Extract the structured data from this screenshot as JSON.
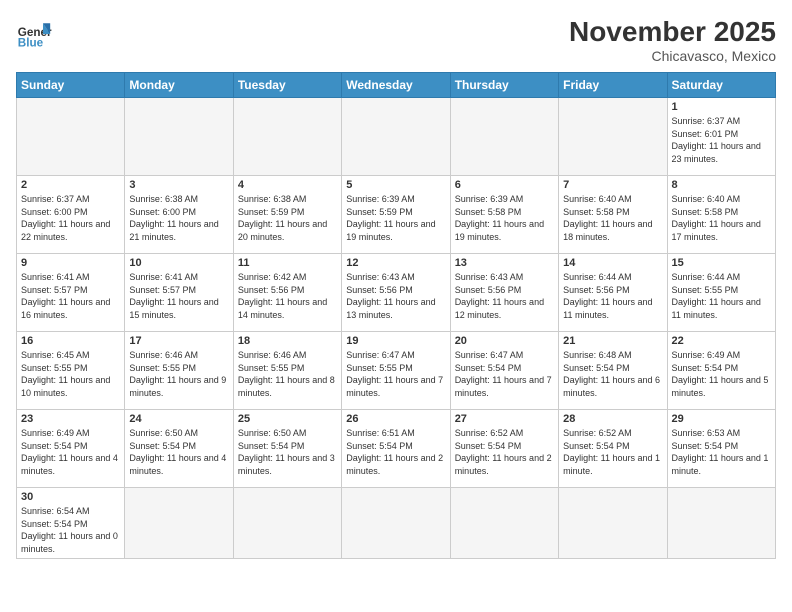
{
  "header": {
    "logo_general": "General",
    "logo_blue": "Blue",
    "month_title": "November 2025",
    "location": "Chicavasco, Mexico"
  },
  "weekdays": [
    "Sunday",
    "Monday",
    "Tuesday",
    "Wednesday",
    "Thursday",
    "Friday",
    "Saturday"
  ],
  "weeks": [
    [
      {
        "day": "",
        "empty": true
      },
      {
        "day": "",
        "empty": true
      },
      {
        "day": "",
        "empty": true
      },
      {
        "day": "",
        "empty": true
      },
      {
        "day": "",
        "empty": true
      },
      {
        "day": "",
        "empty": true
      },
      {
        "day": "1",
        "sunrise": "6:37 AM",
        "sunset": "6:01 PM",
        "daylight": "11 hours and 23 minutes."
      }
    ],
    [
      {
        "day": "2",
        "sunrise": "6:37 AM",
        "sunset": "6:00 PM",
        "daylight": "11 hours and 22 minutes."
      },
      {
        "day": "3",
        "sunrise": "6:38 AM",
        "sunset": "6:00 PM",
        "daylight": "11 hours and 21 minutes."
      },
      {
        "day": "4",
        "sunrise": "6:38 AM",
        "sunset": "5:59 PM",
        "daylight": "11 hours and 20 minutes."
      },
      {
        "day": "5",
        "sunrise": "6:39 AM",
        "sunset": "5:59 PM",
        "daylight": "11 hours and 19 minutes."
      },
      {
        "day": "6",
        "sunrise": "6:39 AM",
        "sunset": "5:58 PM",
        "daylight": "11 hours and 19 minutes."
      },
      {
        "day": "7",
        "sunrise": "6:40 AM",
        "sunset": "5:58 PM",
        "daylight": "11 hours and 18 minutes."
      },
      {
        "day": "8",
        "sunrise": "6:40 AM",
        "sunset": "5:58 PM",
        "daylight": "11 hours and 17 minutes."
      }
    ],
    [
      {
        "day": "9",
        "sunrise": "6:41 AM",
        "sunset": "5:57 PM",
        "daylight": "11 hours and 16 minutes."
      },
      {
        "day": "10",
        "sunrise": "6:41 AM",
        "sunset": "5:57 PM",
        "daylight": "11 hours and 15 minutes."
      },
      {
        "day": "11",
        "sunrise": "6:42 AM",
        "sunset": "5:56 PM",
        "daylight": "11 hours and 14 minutes."
      },
      {
        "day": "12",
        "sunrise": "6:43 AM",
        "sunset": "5:56 PM",
        "daylight": "11 hours and 13 minutes."
      },
      {
        "day": "13",
        "sunrise": "6:43 AM",
        "sunset": "5:56 PM",
        "daylight": "11 hours and 12 minutes."
      },
      {
        "day": "14",
        "sunrise": "6:44 AM",
        "sunset": "5:56 PM",
        "daylight": "11 hours and 11 minutes."
      },
      {
        "day": "15",
        "sunrise": "6:44 AM",
        "sunset": "5:55 PM",
        "daylight": "11 hours and 11 minutes."
      }
    ],
    [
      {
        "day": "16",
        "sunrise": "6:45 AM",
        "sunset": "5:55 PM",
        "daylight": "11 hours and 10 minutes."
      },
      {
        "day": "17",
        "sunrise": "6:46 AM",
        "sunset": "5:55 PM",
        "daylight": "11 hours and 9 minutes."
      },
      {
        "day": "18",
        "sunrise": "6:46 AM",
        "sunset": "5:55 PM",
        "daylight": "11 hours and 8 minutes."
      },
      {
        "day": "19",
        "sunrise": "6:47 AM",
        "sunset": "5:55 PM",
        "daylight": "11 hours and 7 minutes."
      },
      {
        "day": "20",
        "sunrise": "6:47 AM",
        "sunset": "5:54 PM",
        "daylight": "11 hours and 7 minutes."
      },
      {
        "day": "21",
        "sunrise": "6:48 AM",
        "sunset": "5:54 PM",
        "daylight": "11 hours and 6 minutes."
      },
      {
        "day": "22",
        "sunrise": "6:49 AM",
        "sunset": "5:54 PM",
        "daylight": "11 hours and 5 minutes."
      }
    ],
    [
      {
        "day": "23",
        "sunrise": "6:49 AM",
        "sunset": "5:54 PM",
        "daylight": "11 hours and 4 minutes."
      },
      {
        "day": "24",
        "sunrise": "6:50 AM",
        "sunset": "5:54 PM",
        "daylight": "11 hours and 4 minutes."
      },
      {
        "day": "25",
        "sunrise": "6:50 AM",
        "sunset": "5:54 PM",
        "daylight": "11 hours and 3 minutes."
      },
      {
        "day": "26",
        "sunrise": "6:51 AM",
        "sunset": "5:54 PM",
        "daylight": "11 hours and 2 minutes."
      },
      {
        "day": "27",
        "sunrise": "6:52 AM",
        "sunset": "5:54 PM",
        "daylight": "11 hours and 2 minutes."
      },
      {
        "day": "28",
        "sunrise": "6:52 AM",
        "sunset": "5:54 PM",
        "daylight": "11 hours and 1 minute."
      },
      {
        "day": "29",
        "sunrise": "6:53 AM",
        "sunset": "5:54 PM",
        "daylight": "11 hours and 1 minute."
      }
    ],
    [
      {
        "day": "30",
        "sunrise": "6:54 AM",
        "sunset": "5:54 PM",
        "daylight": "11 hours and 0 minutes."
      },
      {
        "day": "",
        "empty": true
      },
      {
        "day": "",
        "empty": true
      },
      {
        "day": "",
        "empty": true
      },
      {
        "day": "",
        "empty": true
      },
      {
        "day": "",
        "empty": true
      },
      {
        "day": "",
        "empty": true
      }
    ]
  ]
}
